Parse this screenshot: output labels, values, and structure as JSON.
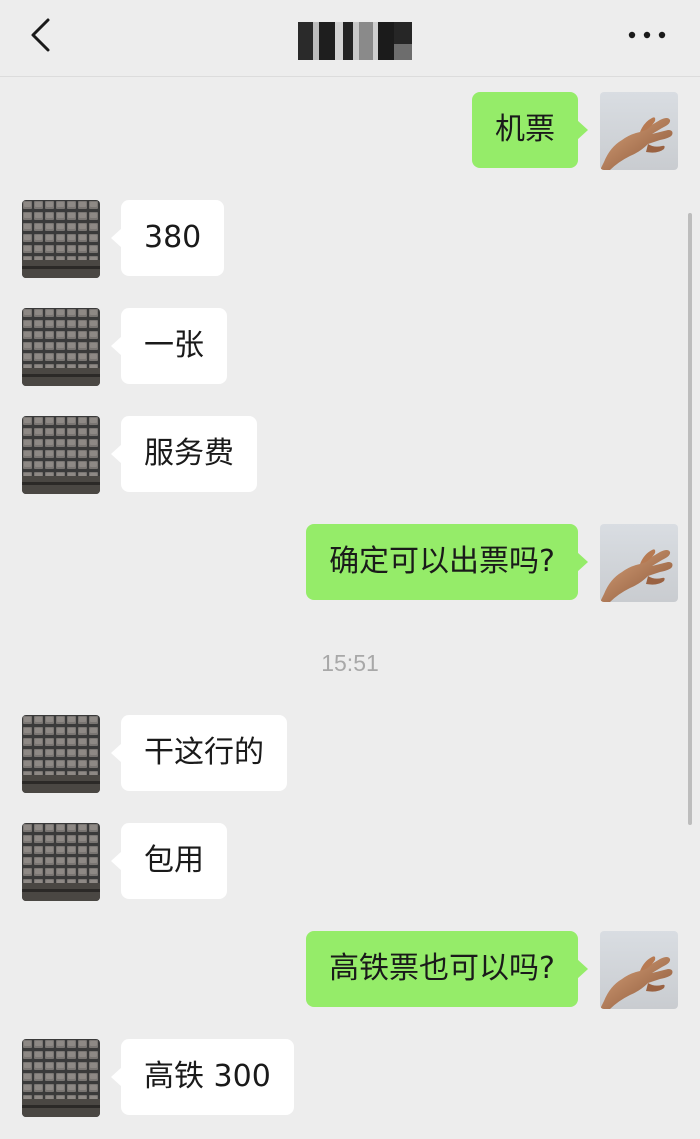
{
  "header": {
    "back_icon": "chevron-left-icon",
    "title": "",
    "more_icon": "more-dots-icon"
  },
  "messages": [
    {
      "side": "out",
      "text": "机票"
    },
    {
      "side": "in",
      "text": "380"
    },
    {
      "side": "in",
      "text": "一张"
    },
    {
      "side": "in",
      "text": "服务费"
    },
    {
      "side": "out",
      "text": "确定可以出票吗?"
    },
    {
      "side": "in",
      "text": "干这行的"
    },
    {
      "side": "in",
      "text": "包用"
    },
    {
      "side": "out",
      "text": "高铁票也可以吗?"
    },
    {
      "side": "in",
      "text": "高铁 300"
    }
  ],
  "timestamp": "15:51",
  "colors": {
    "background": "#ededed",
    "outgoing_bubble": "#95ec69",
    "incoming_bubble": "#ffffff"
  }
}
